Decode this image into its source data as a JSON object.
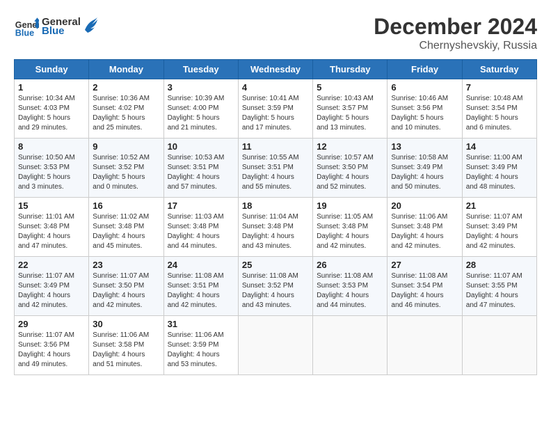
{
  "header": {
    "logo_line1": "General",
    "logo_line2": "Blue",
    "month_title": "December 2024",
    "subtitle": "Chernyshevskiy, Russia"
  },
  "weekdays": [
    "Sunday",
    "Monday",
    "Tuesday",
    "Wednesday",
    "Thursday",
    "Friday",
    "Saturday"
  ],
  "weeks": [
    [
      {
        "day": "1",
        "sunrise": "10:34 AM",
        "sunset": "4:03 PM",
        "daylight": "5 hours and 29 minutes."
      },
      {
        "day": "2",
        "sunrise": "10:36 AM",
        "sunset": "4:02 PM",
        "daylight": "5 hours and 25 minutes."
      },
      {
        "day": "3",
        "sunrise": "10:39 AM",
        "sunset": "4:00 PM",
        "daylight": "5 hours and 21 minutes."
      },
      {
        "day": "4",
        "sunrise": "10:41 AM",
        "sunset": "3:59 PM",
        "daylight": "5 hours and 17 minutes."
      },
      {
        "day": "5",
        "sunrise": "10:43 AM",
        "sunset": "3:57 PM",
        "daylight": "5 hours and 13 minutes."
      },
      {
        "day": "6",
        "sunrise": "10:46 AM",
        "sunset": "3:56 PM",
        "daylight": "5 hours and 10 minutes."
      },
      {
        "day": "7",
        "sunrise": "10:48 AM",
        "sunset": "3:54 PM",
        "daylight": "5 hours and 6 minutes."
      }
    ],
    [
      {
        "day": "8",
        "sunrise": "10:50 AM",
        "sunset": "3:53 PM",
        "daylight": "5 hours and 3 minutes."
      },
      {
        "day": "9",
        "sunrise": "10:52 AM",
        "sunset": "3:52 PM",
        "daylight": "5 hours and 0 minutes."
      },
      {
        "day": "10",
        "sunrise": "10:53 AM",
        "sunset": "3:51 PM",
        "daylight": "4 hours and 57 minutes."
      },
      {
        "day": "11",
        "sunrise": "10:55 AM",
        "sunset": "3:51 PM",
        "daylight": "4 hours and 55 minutes."
      },
      {
        "day": "12",
        "sunrise": "10:57 AM",
        "sunset": "3:50 PM",
        "daylight": "4 hours and 52 minutes."
      },
      {
        "day": "13",
        "sunrise": "10:58 AM",
        "sunset": "3:49 PM",
        "daylight": "4 hours and 50 minutes."
      },
      {
        "day": "14",
        "sunrise": "11:00 AM",
        "sunset": "3:49 PM",
        "daylight": "4 hours and 48 minutes."
      }
    ],
    [
      {
        "day": "15",
        "sunrise": "11:01 AM",
        "sunset": "3:48 PM",
        "daylight": "4 hours and 47 minutes."
      },
      {
        "day": "16",
        "sunrise": "11:02 AM",
        "sunset": "3:48 PM",
        "daylight": "4 hours and 45 minutes."
      },
      {
        "day": "17",
        "sunrise": "11:03 AM",
        "sunset": "3:48 PM",
        "daylight": "4 hours and 44 minutes."
      },
      {
        "day": "18",
        "sunrise": "11:04 AM",
        "sunset": "3:48 PM",
        "daylight": "4 hours and 43 minutes."
      },
      {
        "day": "19",
        "sunrise": "11:05 AM",
        "sunset": "3:48 PM",
        "daylight": "4 hours and 42 minutes."
      },
      {
        "day": "20",
        "sunrise": "11:06 AM",
        "sunset": "3:48 PM",
        "daylight": "4 hours and 42 minutes."
      },
      {
        "day": "21",
        "sunrise": "11:07 AM",
        "sunset": "3:49 PM",
        "daylight": "4 hours and 42 minutes."
      }
    ],
    [
      {
        "day": "22",
        "sunrise": "11:07 AM",
        "sunset": "3:49 PM",
        "daylight": "4 hours and 42 minutes."
      },
      {
        "day": "23",
        "sunrise": "11:07 AM",
        "sunset": "3:50 PM",
        "daylight": "4 hours and 42 minutes."
      },
      {
        "day": "24",
        "sunrise": "11:08 AM",
        "sunset": "3:51 PM",
        "daylight": "4 hours and 42 minutes."
      },
      {
        "day": "25",
        "sunrise": "11:08 AM",
        "sunset": "3:52 PM",
        "daylight": "4 hours and 43 minutes."
      },
      {
        "day": "26",
        "sunrise": "11:08 AM",
        "sunset": "3:53 PM",
        "daylight": "4 hours and 44 minutes."
      },
      {
        "day": "27",
        "sunrise": "11:08 AM",
        "sunset": "3:54 PM",
        "daylight": "4 hours and 46 minutes."
      },
      {
        "day": "28",
        "sunrise": "11:07 AM",
        "sunset": "3:55 PM",
        "daylight": "4 hours and 47 minutes."
      }
    ],
    [
      {
        "day": "29",
        "sunrise": "11:07 AM",
        "sunset": "3:56 PM",
        "daylight": "4 hours and 49 minutes."
      },
      {
        "day": "30",
        "sunrise": "11:06 AM",
        "sunset": "3:58 PM",
        "daylight": "4 hours and 51 minutes."
      },
      {
        "day": "31",
        "sunrise": "11:06 AM",
        "sunset": "3:59 PM",
        "daylight": "4 hours and 53 minutes."
      },
      null,
      null,
      null,
      null
    ]
  ]
}
